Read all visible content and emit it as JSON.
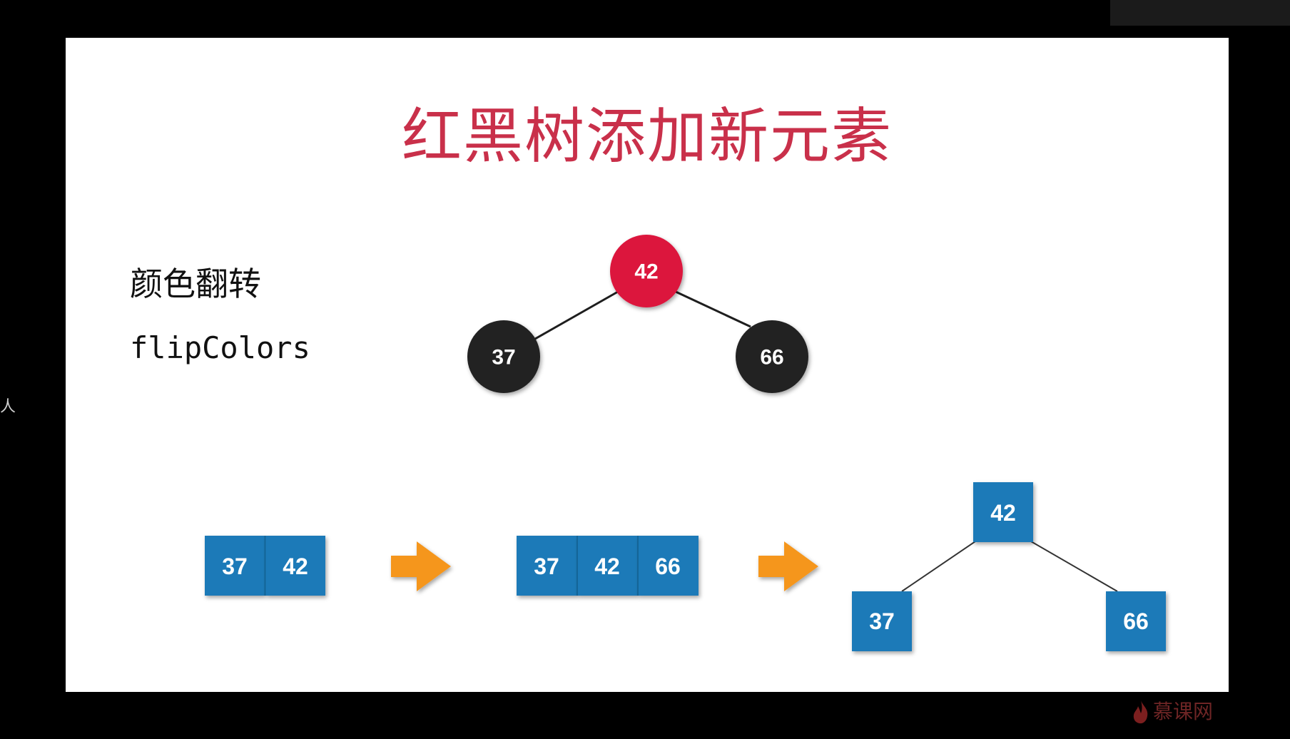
{
  "slide": {
    "title": "红黑树添加新元素",
    "subtitle_cn": "颜色翻转",
    "subtitle_code": "flipColors"
  },
  "side_glyph": "人",
  "watermark": {
    "text": "慕课网",
    "icon": "flame-logo-icon"
  },
  "colors": {
    "title": "#c9304a",
    "red_node": "#dc143c",
    "black_node": "#222222",
    "box_fill": "#1a7ab8",
    "arrow": "#f5961e"
  },
  "red_black_tree": {
    "root": {
      "value": "42",
      "color": "red"
    },
    "left": {
      "value": "37",
      "color": "black"
    },
    "right": {
      "value": "66",
      "color": "black"
    }
  },
  "two_three_sequence": {
    "step1_node": [
      "37",
      "42"
    ],
    "step2_node": [
      "37",
      "42",
      "66"
    ],
    "step3_tree": {
      "root": "42",
      "left": "37",
      "right": "66"
    }
  }
}
